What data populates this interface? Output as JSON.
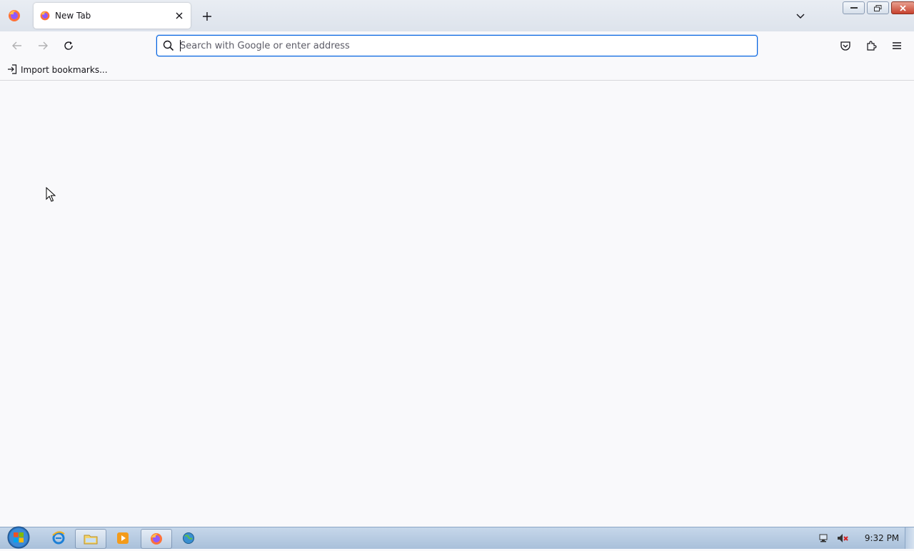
{
  "browser": {
    "tab": {
      "title": "New Tab"
    },
    "urlbar": {
      "placeholder": "Search with Google or enter address",
      "value": ""
    },
    "bookmarks_bar": {
      "import_label": "Import bookmarks..."
    },
    "accent_color": "#0061e0"
  },
  "taskbar": {
    "clock": "9:32 PM",
    "pinned": [
      "internet-explorer-icon",
      "file-explorer-icon",
      "media-player-icon",
      "firefox-icon",
      "network-globe-icon"
    ]
  }
}
